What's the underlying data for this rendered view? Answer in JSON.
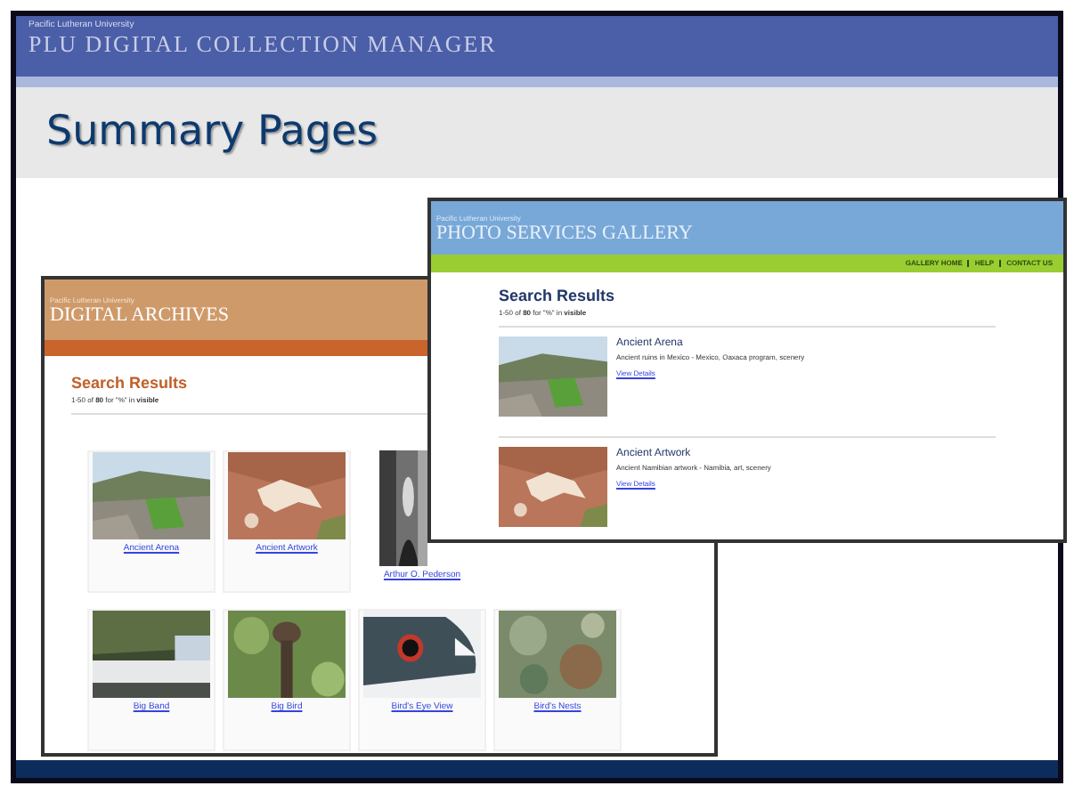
{
  "slide": {
    "org": "Pacific Lutheran University",
    "banner": "PLU DIGITAL COLLECTION MANAGER",
    "title": "Summary Pages"
  },
  "archives": {
    "org": "Pacific Lutheran University",
    "banner": "DIGITAL ARCHIVES",
    "heading": "Search Results",
    "summary": "1-50 of **80** for \"%\" in **visible**",
    "items": [
      {
        "label": "Ancient Arena",
        "kind": "picture"
      },
      {
        "label": "Ancient Artwork",
        "kind": "picture"
      },
      {
        "label": "Arthur O. Pederson",
        "kind": "partial"
      },
      {
        "kind": "hidden"
      },
      {
        "label": "Big Band",
        "kind": "picture"
      },
      {
        "label": "Big Bird",
        "kind": "picture"
      },
      {
        "label": "Bird's Eye View",
        "kind": "picture"
      },
      {
        "label": "Bird's Nests",
        "kind": "picture"
      }
    ]
  },
  "gallery": {
    "org": "Pacific Lutheran University",
    "banner": "PHOTO SERVICES GALLERY",
    "nav": [
      "GALLERY HOME",
      "HELP",
      "CONTACT US"
    ],
    "heading": "Search Results",
    "summary": "1-50 of **80** for \"%\" in **visible**",
    "results": [
      {
        "title": "Ancient Arena",
        "description": "Ancient ruins in Mexico - Mexico, Oaxaca program, scenery",
        "link": "View Details"
      },
      {
        "title": "Ancient Artwork",
        "description": "Ancient Namibian artwork - Namibia, art, scenery",
        "link": "View Details"
      }
    ]
  }
}
